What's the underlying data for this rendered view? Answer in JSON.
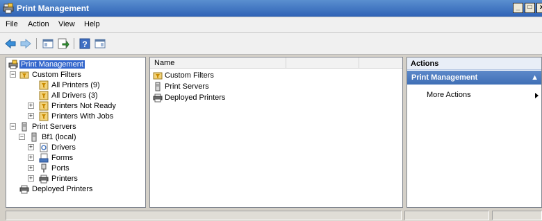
{
  "window": {
    "title": "Print Management",
    "buttons": {
      "minimize": "_",
      "maximize": "□",
      "close": "x"
    }
  },
  "menubar": {
    "items": [
      {
        "label": "File"
      },
      {
        "label": "Action"
      },
      {
        "label": "View"
      },
      {
        "label": "Help"
      }
    ]
  },
  "toolbar": {
    "buttons": [
      {
        "icon": "back-arrow-icon"
      },
      {
        "icon": "forward-arrow-icon"
      },
      {
        "icon": "show-hide-console-tree-icon"
      },
      {
        "icon": "export-list-icon"
      },
      {
        "icon": "help-icon"
      },
      {
        "icon": "show-hide-action-pane-icon"
      }
    ]
  },
  "tree": {
    "items": [
      {
        "label": "Print Management",
        "icon": "print-management-icon",
        "selected": true
      },
      {
        "label": "Custom Filters",
        "expander": "−",
        "icon": "filter-folder-icon"
      },
      {
        "label": "All Printers (9)",
        "icon": "filter-icon"
      },
      {
        "label": "All Drivers (3)",
        "icon": "filter-icon"
      },
      {
        "label": "Printers Not Ready",
        "expander": "+",
        "icon": "filter-icon"
      },
      {
        "label": "Printers With Jobs",
        "expander": "+",
        "icon": "filter-icon"
      },
      {
        "label": "Print Servers",
        "expander": "−",
        "icon": "server-icon"
      },
      {
        "label": "Bf1 (local)",
        "expander": "−",
        "icon": "server-icon"
      },
      {
        "label": "Drivers",
        "expander": "+",
        "icon": "driver-icon"
      },
      {
        "label": "Forms",
        "expander": "+",
        "icon": "forms-icon"
      },
      {
        "label": "Ports",
        "expander": "+",
        "icon": "port-icon"
      },
      {
        "label": "Printers",
        "expander": "+",
        "icon": "printer-icon"
      },
      {
        "label": "Deployed Printers",
        "icon": "printer-icon"
      }
    ]
  },
  "list": {
    "columns": [
      {
        "label": "Name"
      },
      {
        "label": ""
      }
    ],
    "rows": [
      {
        "label": "Custom Filters",
        "icon": "filter-folder-icon"
      },
      {
        "label": "Print Servers",
        "icon": "server-icon"
      },
      {
        "label": "Deployed Printers",
        "icon": "printer-icon"
      }
    ]
  },
  "actions": {
    "header": "Actions",
    "section": "Print Management",
    "section_caret": "▲",
    "items": [
      {
        "label": "More Actions"
      }
    ]
  },
  "colors": {
    "selection": "#3366cc",
    "title_bar": "#2f62b5",
    "actions_section": "#4a78bd"
  }
}
